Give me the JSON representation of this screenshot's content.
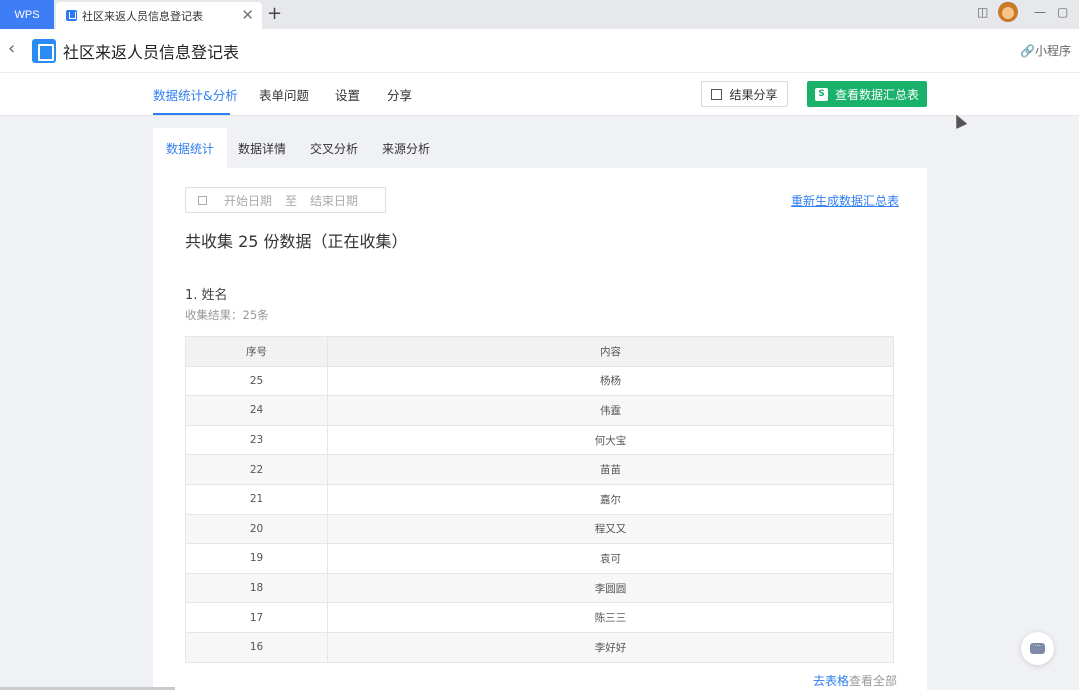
{
  "tabbar": {
    "wps_label": "WPS",
    "doc_tab_title": "社区来返人员信息登记表",
    "close_glyph": "✕",
    "new_tab_glyph": "+"
  },
  "header": {
    "back_glyph": "‹",
    "title": "社区来返人员信息登记表",
    "mini_program": "小程序"
  },
  "nav": {
    "items": [
      "数据统计&分析",
      "表单问题",
      "设置",
      "分享"
    ],
    "share_button": "结果分享",
    "view_button": "查看数据汇总表",
    "view_button_icon": "S"
  },
  "subtabs": [
    "数据统计",
    "数据详情",
    "交叉分析",
    "来源分析"
  ],
  "filter": {
    "start_placeholder": "开始日期",
    "to": "至",
    "end_placeholder": "结束日期",
    "regen_link": "重新生成数据汇总表"
  },
  "summary": "共收集 25 份数据（正在收集）",
  "question": {
    "title": "1.  姓名",
    "result": "收集结果：25条",
    "columns": [
      "序号",
      "内容"
    ],
    "rows": [
      [
        "25",
        "杨杨"
      ],
      [
        "24",
        "伟霆"
      ],
      [
        "23",
        "何大宝"
      ],
      [
        "22",
        "苗苗"
      ],
      [
        "21",
        "嘉尔"
      ],
      [
        "20",
        "程又又"
      ],
      [
        "19",
        "袁可"
      ],
      [
        "18",
        "李圆圆"
      ],
      [
        "17",
        "陈三三"
      ],
      [
        "16",
        "李好好"
      ]
    ],
    "see_all_link": "去表格",
    "see_all_text": "查看全部"
  },
  "colors": {
    "accent": "#2f7ef2",
    "green": "#1ab26b",
    "wps_blue": "#3d7df5"
  }
}
